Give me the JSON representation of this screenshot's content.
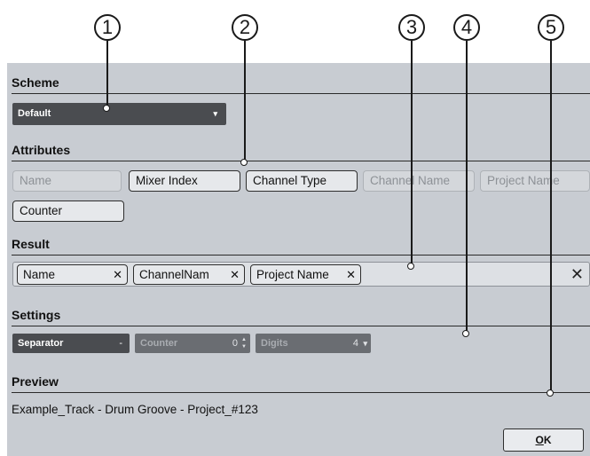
{
  "callouts": [
    "1",
    "2",
    "3",
    "4",
    "5"
  ],
  "scheme": {
    "title": "Scheme",
    "value": "Default",
    "arrow": "▾"
  },
  "attributes": {
    "title": "Attributes",
    "items": [
      {
        "label": "Name",
        "enabled": false
      },
      {
        "label": "Mixer Index",
        "enabled": true
      },
      {
        "label": "Channel Type",
        "enabled": true
      },
      {
        "label": "Channel Name",
        "enabled": false
      },
      {
        "label": "Project Name",
        "enabled": false
      },
      {
        "label": "Counter",
        "enabled": true
      }
    ]
  },
  "result": {
    "title": "Result",
    "chips": [
      {
        "label": "Name",
        "remove": "✕"
      },
      {
        "label": "ChannelNam",
        "remove": "✕"
      },
      {
        "label": "Project Name",
        "remove": "✕"
      }
    ],
    "clear": "✕"
  },
  "settings": {
    "title": "Settings",
    "separator": {
      "label": "Separator",
      "value": "-"
    },
    "counter": {
      "label": "Counter",
      "value": "0",
      "spin": "▲▼"
    },
    "digits": {
      "label": "Digits",
      "value": "4",
      "arrow": "▾"
    }
  },
  "preview": {
    "title": "Preview",
    "text": "Example_Track - Drum Groove - Project_#123"
  },
  "ok_button": {
    "label": "OK",
    "mnemonic": "O",
    "rest": "K"
  },
  "colors": {
    "dialog_bg": "#c8ccd2",
    "dark_field": "#4a4c50",
    "chip_bg": "#e6e8eb"
  }
}
